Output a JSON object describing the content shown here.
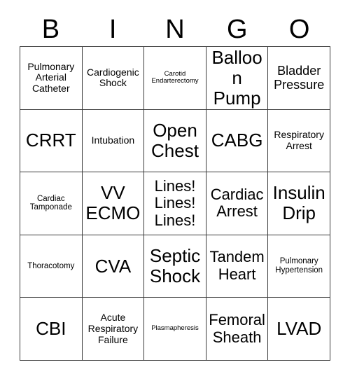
{
  "card": {
    "headers": [
      "B",
      "I",
      "N",
      "G",
      "O"
    ],
    "rows": [
      [
        {
          "label": "Pulmonary Arterial Catheter",
          "size": "s-md"
        },
        {
          "label": "Cardiogenic Shock",
          "size": "s-md"
        },
        {
          "label": "Carotid Endarterectomy",
          "size": "s-xs"
        },
        {
          "label": "Balloon Pump",
          "size": "s-xxl"
        },
        {
          "label": "Bladder Pressure",
          "size": "s-lg"
        }
      ],
      [
        {
          "label": "CRRT",
          "size": "s-xxl"
        },
        {
          "label": "Intubation",
          "size": "s-md"
        },
        {
          "label": "Open Chest",
          "size": "s-xxl"
        },
        {
          "label": "CABG",
          "size": "s-xxl"
        },
        {
          "label": "Respiratory Arrest",
          "size": "s-md"
        }
      ],
      [
        {
          "label": "Cardiac Tamponade",
          "size": "s-sm"
        },
        {
          "label": "VV ECMO",
          "size": "s-xxl"
        },
        {
          "label": "Lines! Lines! Lines!",
          "size": "s-xl"
        },
        {
          "label": "Cardiac Arrest",
          "size": "s-xl"
        },
        {
          "label": "Insulin Drip",
          "size": "s-xxl"
        }
      ],
      [
        {
          "label": "Thoracotomy",
          "size": "s-sm"
        },
        {
          "label": "CVA",
          "size": "s-xxl"
        },
        {
          "label": "Septic Shock",
          "size": "s-xxl"
        },
        {
          "label": "Tandem Heart",
          "size": "s-xl"
        },
        {
          "label": "Pulmonary Hypertension",
          "size": "s-sm"
        }
      ],
      [
        {
          "label": "CBI",
          "size": "s-xxl"
        },
        {
          "label": "Acute Respiratory Failure",
          "size": "s-md"
        },
        {
          "label": "Plasmapheresis",
          "size": "s-xs"
        },
        {
          "label": "Femoral Sheath",
          "size": "s-xl"
        },
        {
          "label": "LVAD",
          "size": "s-xxl"
        }
      ]
    ]
  },
  "colors": {
    "border": "#3a3a3a",
    "text": "#000000",
    "background": "#ffffff"
  }
}
